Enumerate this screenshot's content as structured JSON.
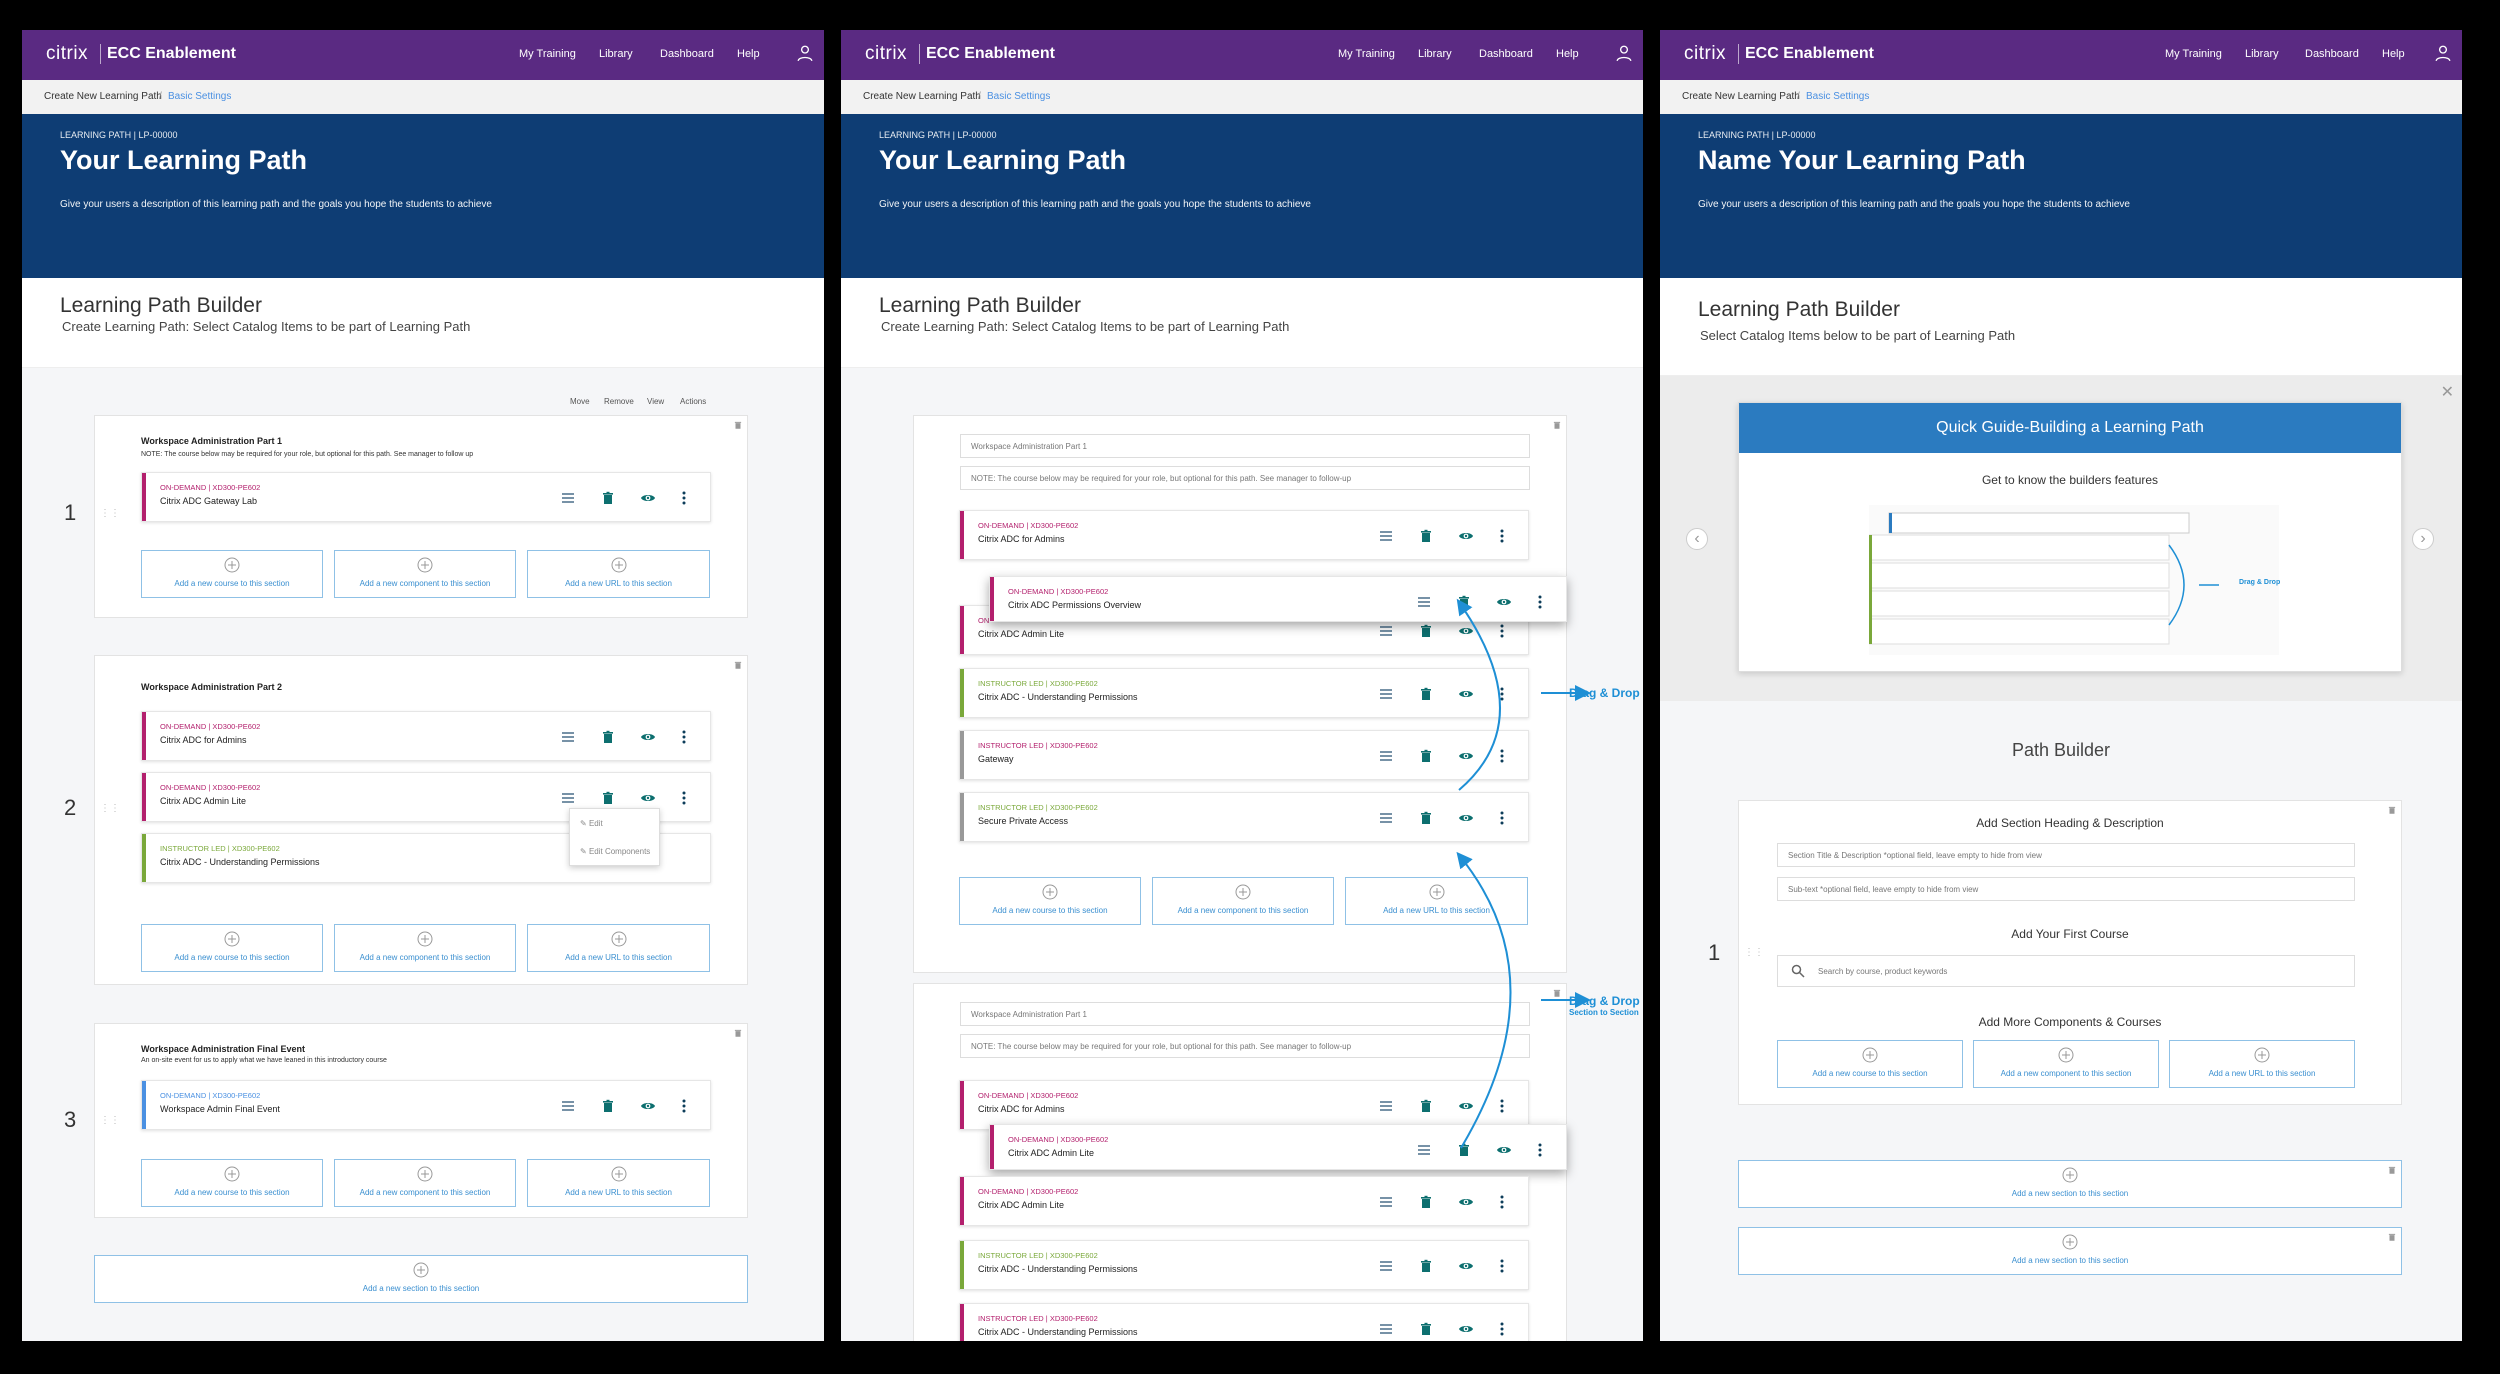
{
  "nav": {
    "logo": "citrix",
    "brand": "ECC Enablement",
    "links": [
      "My Training",
      "Library",
      "Dashboard",
      "Help"
    ]
  },
  "breadcrumb": {
    "first": "Create New Learning Path",
    "sep": "/",
    "current": "Basic Settings"
  },
  "legend": {
    "move": "Move",
    "remove": "Remove",
    "view": "View",
    "actions": "Actions"
  },
  "add": {
    "course": "Add a new course to this section",
    "component": "Add a new component to this section",
    "url": "Add a new URL to this section",
    "section": "Add a new section to this section"
  },
  "screen1": {
    "hero": {
      "kicker": "LEARNING PATH | LP-00000",
      "title": "Your Learning Path",
      "desc": "Give your users a description of this learning path and the goals you hope the students to achieve"
    },
    "builder": {
      "title": "Learning Path Builder",
      "subtitle": "Create Learning Path: Select Catalog Items to be part of Learning Path"
    },
    "sections": [
      {
        "num": "1",
        "title": "Workspace Administration Part 1",
        "note": "NOTE: The course below may be required for your role, but optional for this path. See manager to follow up",
        "cards": [
          {
            "kicker": "ON-DEMAND | XD300-PE602",
            "title": "Citrix ADC Gateway Lab"
          }
        ]
      },
      {
        "num": "2",
        "title": "Workspace Administration Part 2",
        "cards": [
          {
            "kicker": "ON-DEMAND | XD300-PE602",
            "title": "Citrix ADC for Admins"
          },
          {
            "kicker": "ON-DEMAND | XD300-PE602",
            "title": "Citrix ADC Admin Lite"
          },
          {
            "kicker": "INSTRUCTOR LED | XD300-PE602",
            "title": "Citrix ADC - Understanding Permissions"
          }
        ],
        "menu": [
          "Edit",
          "Edit Components"
        ]
      },
      {
        "num": "3",
        "title": "Workspace Administration Final Event",
        "note": "An on-site event for us to apply what we have leaned in this introductory course",
        "cards": [
          {
            "kicker": "ON-DEMAND | XD300-PE602",
            "title": "Workspace Admin Final Event"
          }
        ]
      }
    ]
  },
  "screen2": {
    "hero": {
      "kicker": "LEARNING PATH | LP-00000",
      "title": "Your Learning Path",
      "desc": "Give your users a description of this learning path and the goals you hope the students to achieve"
    },
    "builder": {
      "title": "Learning Path Builder",
      "subtitle": "Create Learning Path: Select Catalog Items to be part of Learning Path"
    },
    "sectionA": {
      "title": "Workspace Administration Part 1",
      "note": "NOTE: The course below may be required for your role, but optional for this path. See manager to follow-up",
      "cards": [
        {
          "kicker": "ON-DEMAND | XD300-PE602",
          "title": "Citrix ADC for Admins"
        },
        {
          "kicker": "ON",
          "title": "Citrix ADC Admin Lite"
        },
        {
          "kicker": "INSTRUCTOR LED | XD300-PE602",
          "title": "Citrix ADC - Understanding Permissions"
        },
        {
          "kicker": "INSTRUCTOR LED | XD300-PE602",
          "title": "Gateway"
        },
        {
          "kicker": "INSTRUCTOR LED | XD300-PE602",
          "title": "Secure Private Access"
        }
      ],
      "floating": {
        "kicker": "ON-DEMAND | XD300-PE602",
        "title": "Citrix ADC Permissions Overview"
      }
    },
    "sectionB": {
      "title": "Workspace Administration Part 1",
      "note": "NOTE: The course below may be required for your role, but optional for this path. See manager to follow-up",
      "cards": [
        {
          "kicker": "ON-DEMAND | XD300-PE602",
          "title": "Citrix ADC for Admins"
        },
        {
          "kicker": "ON-DEMAND | XD300-PE602",
          "title": "Citrix ADC Admin Lite"
        },
        {
          "kicker": "INSTRUCTOR LED | XD300-PE602",
          "title": "Citrix ADC - Understanding Permissions"
        },
        {
          "kicker": "INSTRUCTOR LED | XD300-PE602",
          "title": "Citrix ADC - Understanding Permissions"
        }
      ],
      "floating": {
        "kicker": "ON-DEMAND | XD300-PE602",
        "title": "Citrix ADC Admin Lite"
      }
    },
    "dd1": "Drag & Drop",
    "dd2": "Drag & Drop",
    "dd2sub": "Section to Section"
  },
  "screen3": {
    "hero": {
      "kicker": "LEARNING PATH | LP-00000",
      "title": "Name Your Learning Path",
      "desc": "Give your users  a description of this learning path and the goals you hope the students to achieve"
    },
    "builder": {
      "title": "Learning Path Builder",
      "subtitle": "Select Catalog Items below to be part of Learning Path"
    },
    "guide": {
      "title": "Quick Guide-Building a Learning Path",
      "subtitle": "Get to know the builders features",
      "dd": "Drag & Drop"
    },
    "path_builder": "Path Builder",
    "section": {
      "num": "1",
      "heading": "Add Section Heading & Description",
      "title_ph": "Section Title & Description *optional field, leave empty to hide from view",
      "sub_ph": "Sub-text *optional field, leave empty to hide from view",
      "first": "Add Your First Course",
      "search_ph": "Search by course, product keywords",
      "more": "Add More Components & Courses"
    }
  },
  "colors": {
    "purple": "#5a2a82",
    "navy": "#0e3d74",
    "ondemand": "#b3206d",
    "instructor": "#7aa83a",
    "teal": "#0d6f6f",
    "blue": "#2b7bc0"
  }
}
